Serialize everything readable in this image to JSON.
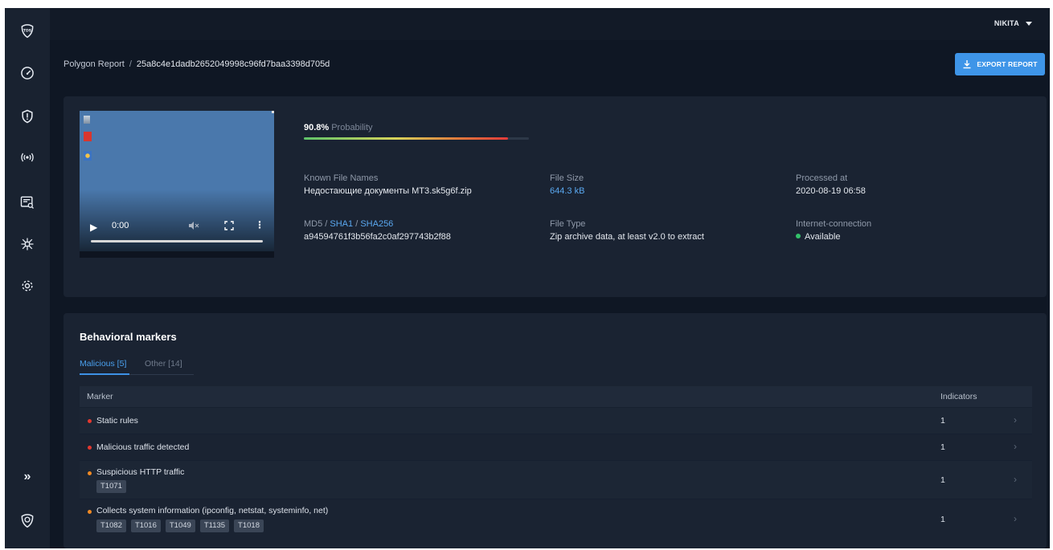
{
  "colors": {
    "accent": "#3e95e8",
    "critical": "#e3382f",
    "warning": "#f08a24",
    "ok": "#33c26a"
  },
  "sidebar": {
    "logo_text": "TDS",
    "items": [
      {
        "name": "dashboard-gauge-icon"
      },
      {
        "name": "shield-alert-icon"
      },
      {
        "name": "wireless-signal-icon"
      },
      {
        "name": "report-search-icon"
      },
      {
        "name": "network-graph-icon"
      },
      {
        "name": "gear-icon"
      }
    ],
    "expand_label": "»",
    "bottom_logo": "circular-logo-icon"
  },
  "topbar": {
    "user": "NIKITA"
  },
  "breadcrumb": {
    "root": "Polygon Report",
    "separator": "/",
    "hash": "25a8c4e1dadb2652049998c96fd7baa3398d705d"
  },
  "export_button": {
    "label": "EXPORT REPORT"
  },
  "summary": {
    "video": {
      "time": "0:00"
    },
    "probability": {
      "value_text": "90.8%",
      "label": "Probability",
      "value": 0.908
    },
    "known_file_names": {
      "label": "Known File Names",
      "value": "Недостающие документы МТ3.sk5g6f.zip"
    },
    "file_size": {
      "label": "File Size",
      "value": "644.3 kB"
    },
    "processed_at": {
      "label": "Processed at",
      "value": "2020-08-19 06:58"
    },
    "hash": {
      "label_md5": "MD5",
      "label_sep": " / ",
      "label_sha1": "SHA1",
      "label_sha256": "SHA256",
      "value": "a94594761f3b56fa2c0af297743b2f88"
    },
    "file_type": {
      "label": "File Type",
      "value": "Zip archive data, at least v2.0 to extract"
    },
    "internet": {
      "label": "Internet-connection",
      "value": "Available"
    }
  },
  "behavioral": {
    "title": "Behavioral markers",
    "tabs": [
      {
        "label": "Malicious [5]",
        "active": true
      },
      {
        "label": "Other [14]",
        "active": false
      }
    ],
    "columns": {
      "marker": "Marker",
      "indicators": "Indicators"
    },
    "rows": [
      {
        "severity": "critical",
        "name": "Static rules",
        "indicators": "1",
        "tags": []
      },
      {
        "severity": "critical",
        "name": "Malicious traffic detected",
        "indicators": "1",
        "tags": []
      },
      {
        "severity": "warning",
        "name": "Suspicious HTTP traffic",
        "indicators": "1",
        "tags": [
          "T1071"
        ]
      },
      {
        "severity": "warning",
        "name": "Collects system information (ipconfig, netstat, systeminfo, net)",
        "indicators": "1",
        "tags": [
          "T1082",
          "T1016",
          "T1049",
          "T1135",
          "T1018"
        ]
      }
    ]
  }
}
